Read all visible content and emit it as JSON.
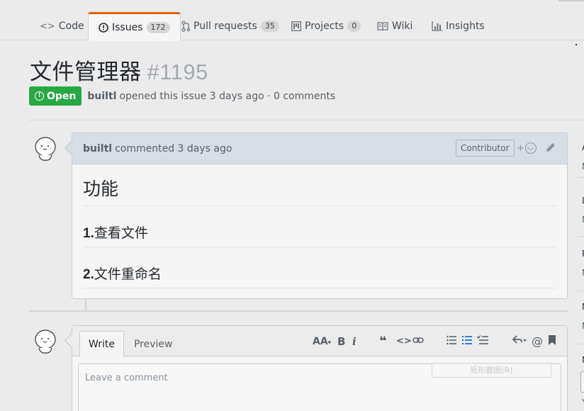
{
  "tabs": [
    {
      "label": "Code",
      "icon": "code-icon"
    },
    {
      "label": "Issues",
      "icon": "issue-opened-icon",
      "count": "172"
    },
    {
      "label": "Pull requests",
      "icon": "git-pull-request-icon",
      "count": "35"
    },
    {
      "label": "Projects",
      "icon": "project-icon",
      "count": "0"
    },
    {
      "label": "Wiki",
      "icon": "book-icon"
    },
    {
      "label": "Insights",
      "icon": "graph-icon"
    }
  ],
  "issue": {
    "title": "文件管理器",
    "number": "#1195",
    "state": "Open",
    "author": "builtl",
    "meta_text": "opened this issue 3 days ago · 0 comments"
  },
  "comment": {
    "author": "builtl",
    "action": "commented 3 days ago",
    "badge": "Contributor",
    "react_plus": "+",
    "body": {
      "heading": "功能",
      "items": [
        {
          "num": "1.",
          "text": "查看文件"
        },
        {
          "num": "2.",
          "text": "文件重命名"
        }
      ]
    }
  },
  "editor": {
    "tab_write": "Write",
    "tab_preview": "Preview",
    "placeholder": "Leave a comment",
    "tools": {
      "heading": "AA",
      "bold": "B",
      "italic": "i",
      "quote": "❝",
      "code": "<>",
      "mention": "@"
    },
    "screenshot_tip": "矩形截图(R)"
  },
  "sidebar_letters": [
    "A",
    "N",
    "L",
    "N",
    "P",
    "N",
    "N",
    "N",
    "N",
    "Y"
  ],
  "colors": {
    "open_green": "#28a745",
    "selected_tab_accent": "#e36209",
    "link_blue": "#0366d6"
  }
}
